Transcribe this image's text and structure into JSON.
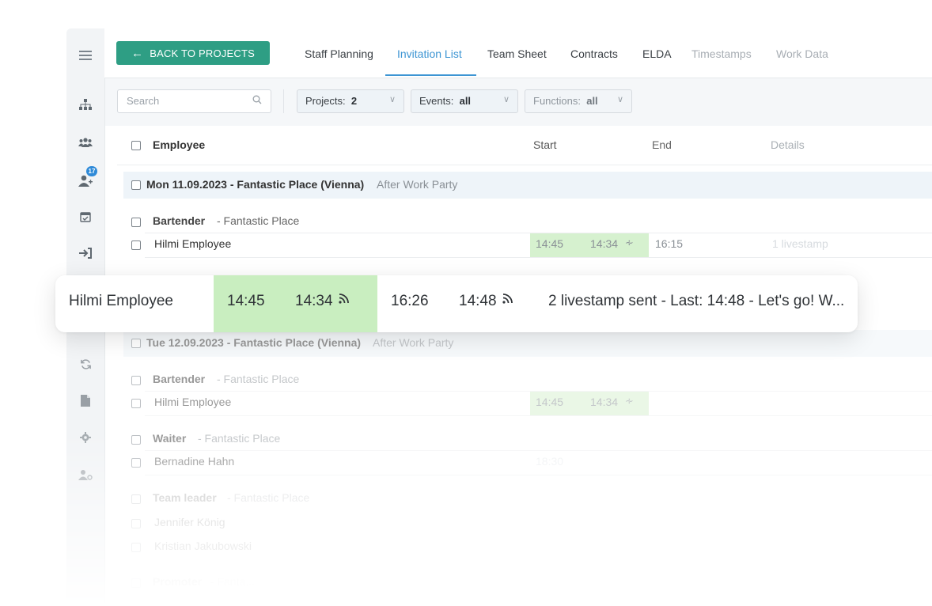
{
  "nav": {
    "back_button": "BACK TO PROJECTS",
    "tabs": [
      {
        "label": "Staff Planning",
        "state": "normal"
      },
      {
        "label": "Invitation List",
        "state": "active"
      },
      {
        "label": "Team Sheet",
        "state": "normal"
      },
      {
        "label": "Contracts",
        "state": "normal"
      },
      {
        "label": "ELDA",
        "state": "normal"
      },
      {
        "label": "Timestamps",
        "state": "faded"
      },
      {
        "label": "Work Data",
        "state": "faded"
      }
    ]
  },
  "sidebar": {
    "icons": [
      "menu-icon",
      "org-chart-icon",
      "users-icon",
      "add-user-icon",
      "calendar-check-icon",
      "sign-in-icon",
      "sync-icon",
      "file-icon",
      "settings-icon",
      "user-settings-icon"
    ],
    "badge": "17"
  },
  "filters": {
    "search_placeholder": "Search",
    "projects_label": "Projects:",
    "projects_value": "2",
    "events_label": "Events:",
    "events_value": "all",
    "functions_label": "Functions:",
    "functions_value": "all"
  },
  "table": {
    "columns": {
      "employee": "Employee",
      "start": "Start",
      "end": "End",
      "details": "Details"
    },
    "groups": [
      {
        "date": "Mon 11.09.2023 - Fantastic Place (Vienna)",
        "event": "After Work Party",
        "functions": [
          {
            "role": "Bartender",
            "place": "- Fantastic Place",
            "rows": [
              {
                "name": "Hilmi Employee",
                "start": "14:45",
                "start_stamp": "14:34",
                "end": "16:15",
                "details": "1 livestamp"
              }
            ]
          }
        ]
      },
      {
        "date": "Tue 12.09.2023 - Fantastic Place (Vienna)",
        "event": "After Work Party",
        "functions": [
          {
            "role": "Bartender",
            "place": "- Fantastic Place",
            "rows": [
              {
                "name": "Hilmi Employee",
                "start": "14:45",
                "start_stamp": "14:34"
              }
            ]
          },
          {
            "role": "Waiter",
            "place": "- Fantastic Place",
            "rows": [
              {
                "name": "Bernadine Hahn",
                "start": "18:30"
              }
            ]
          },
          {
            "role": "Team leader",
            "place": "- Fantastic Place",
            "rows": [
              {
                "name": "Jennifer König"
              },
              {
                "name": "Kristian Jakubowski"
              }
            ]
          },
          {
            "role": "Promoter",
            "place": "- Fanta...",
            "rows": []
          }
        ]
      }
    ]
  },
  "highlight": {
    "name": "Hilmi Employee",
    "start": "14:45",
    "start_stamp": "14:34",
    "end": "16:26",
    "end_stamp": "14:48",
    "details": "2 livestamp sent - Last: 14:48 - Let's go! W..."
  }
}
